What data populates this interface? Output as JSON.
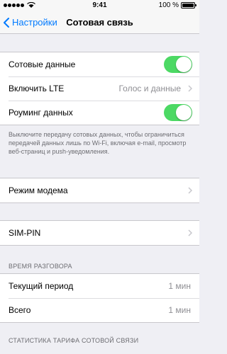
{
  "status_bar": {
    "time": "9:41",
    "battery": "100 %",
    "signal_icon": "signal-dots-icon",
    "wifi_icon": "wifi-icon",
    "battery_icon": "battery-icon"
  },
  "nav": {
    "back_label": "Настройки",
    "title": "Сотовая связь"
  },
  "section1": [
    {
      "label": "Сотовые данные",
      "control": "toggle",
      "on": true
    },
    {
      "label": "Включить LTE",
      "value": "Голос и данные",
      "control": "chevron"
    },
    {
      "label": "Роуминг данных",
      "control": "toggle",
      "on": true
    }
  ],
  "footnote1": "Выключите передачу сотовых данных, чтобы ограничиться передачей данных лишь по Wi-Fi, включая e-mail, просмотр веб-страниц и push-уведомления.",
  "section2": [
    {
      "label": "Режим модема",
      "control": "chevron"
    }
  ],
  "section3": [
    {
      "label": "SIM-PIN",
      "control": "chevron"
    }
  ],
  "call_time_header": "ВРЕМЯ РАЗГОВОРА",
  "call_time": [
    {
      "label": "Текущий период",
      "value": "1 мин"
    },
    {
      "label": "Всего",
      "value": "1 мин"
    }
  ],
  "stats_header": "СТАТИСТИКА ТАРИФА СОТОВОЙ СВЯЗИ",
  "colors": {
    "accent": "#007aff",
    "toggle_on": "#4cd964",
    "background": "#efeff4"
  }
}
